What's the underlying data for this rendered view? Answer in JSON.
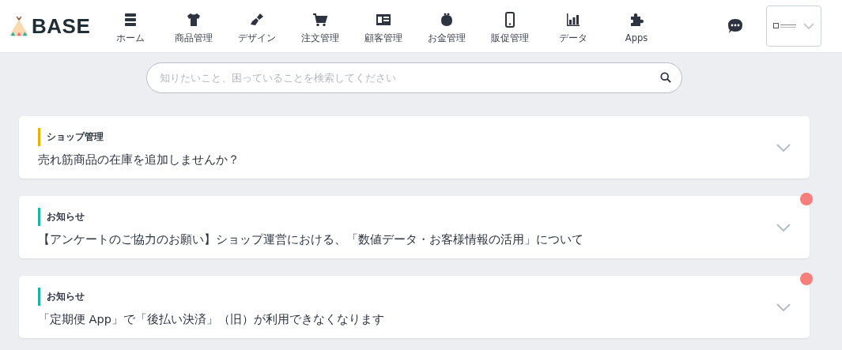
{
  "header": {
    "logo": "BASE",
    "nav": [
      {
        "label": "ホーム"
      },
      {
        "label": "商品管理"
      },
      {
        "label": "デザイン"
      },
      {
        "label": "注文管理"
      },
      {
        "label": "顧客管理"
      },
      {
        "label": "お金管理"
      },
      {
        "label": "販促管理"
      },
      {
        "label": "データ"
      },
      {
        "label": "Apps"
      }
    ]
  },
  "search": {
    "placeholder": "知りたいこと、困っていることを検索してください"
  },
  "notices": [
    {
      "category": "ショップ管理",
      "color": "#e6b400",
      "title": "売れ筋商品の在庫を追加しませんか？",
      "unread": false
    },
    {
      "category": "お知らせ",
      "color": "#1bb3a5",
      "title": "【アンケートのご協力のお願い】ショップ運営における、「数値データ・お客様情報の活用」について",
      "unread": true
    },
    {
      "category": "お知らせ",
      "color": "#1bb3a5",
      "title": "「定期便 App」で「後払い決済」（旧）が利用できなくなります",
      "unread": true
    }
  ]
}
